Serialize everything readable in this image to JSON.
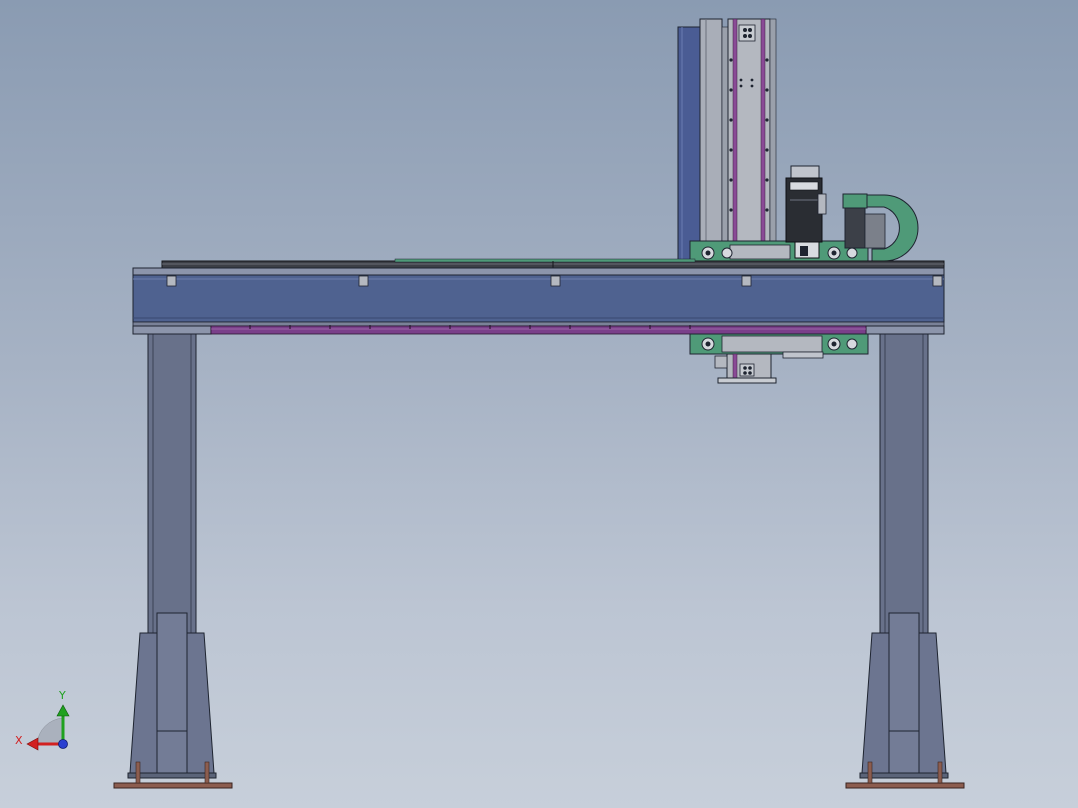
{
  "viewport": {
    "background_top": "#8a9bb2",
    "background_bottom": "#c7cfda"
  },
  "model": {
    "frame_color": "#4f6290",
    "leg_color": "#68718a",
    "rack_color": "#7a3f8a",
    "carriage_color": "#4f9a78",
    "cable_chain_color": "#4f9a78",
    "base_plate_color": "#8c5d4f"
  },
  "triad": {
    "x_label": "X",
    "y_label": "Y",
    "x_color": "#d22020",
    "y_color": "#1fa11f",
    "z_color": "#2a3fd0"
  }
}
